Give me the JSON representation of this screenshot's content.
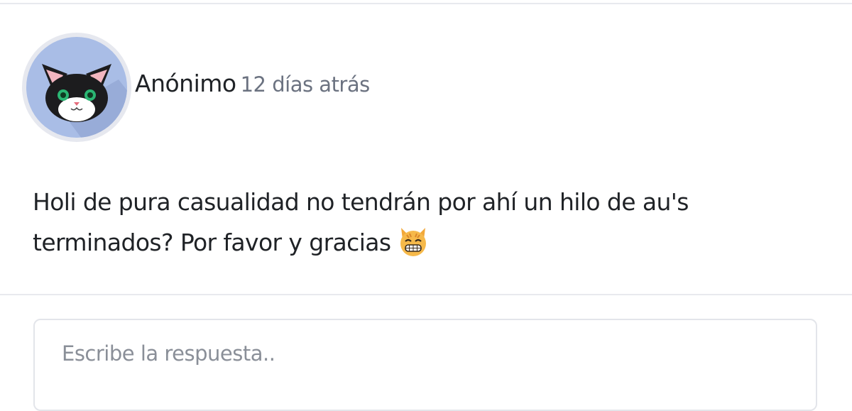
{
  "post": {
    "author": "Anónimo",
    "timestamp": "12 días atrás",
    "body_line1": "Holi de pura casualidad no tendrán por ahí un hilo de au's",
    "body_line2": "terminados? Por favor y gracias",
    "emoji": "grinning-cat-icon"
  },
  "reply": {
    "placeholder": "Escribe la respuesta.."
  },
  "colors": {
    "avatar_bg": "#a9bde6",
    "avatar_ring": "#e6e8ef",
    "timestamp_text": "#6b7280",
    "divider": "#e8e9ee"
  }
}
